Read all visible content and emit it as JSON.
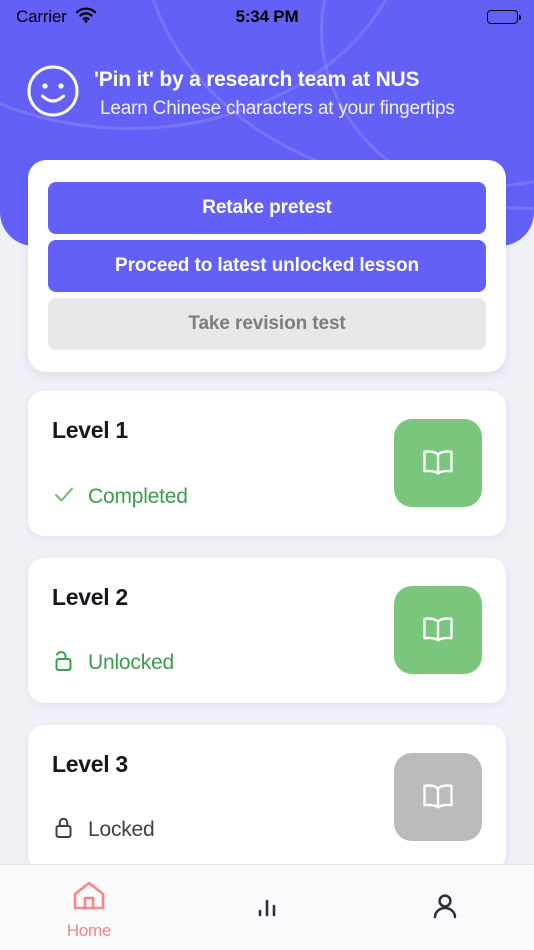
{
  "status_bar": {
    "carrier": "Carrier",
    "wifi_icon": "wifi-icon",
    "time": "5:34 PM",
    "battery_icon": "battery-full-icon"
  },
  "header": {
    "logo_icon": "smiley-face-icon",
    "title": "'Pin it' by a research team at NUS",
    "subtitle": "Learn Chinese characters at your fingertips",
    "background_color": "#6360f7"
  },
  "actions": {
    "buttons": [
      {
        "label": "Retake pretest",
        "state": "enabled"
      },
      {
        "label": "Proceed to latest unlocked lesson",
        "state": "enabled"
      },
      {
        "label": "Take revision test",
        "state": "disabled"
      }
    ]
  },
  "levels": [
    {
      "title": "Level 1",
      "status_label": "Completed",
      "status_icon": "check-icon",
      "status_color": "#3a9e4a",
      "book_icon": "open-book-icon",
      "book_color": "#7ac67c",
      "book_state": "enabled"
    },
    {
      "title": "Level 2",
      "status_label": "Unlocked",
      "status_icon": "unlock-icon",
      "status_color": "#3a9e4a",
      "book_icon": "open-book-icon",
      "book_color": "#7ac67c",
      "book_state": "enabled"
    },
    {
      "title": "Level 3",
      "status_label": "Locked",
      "status_icon": "lock-icon",
      "status_color": "#3c4049",
      "book_icon": "open-book-icon",
      "book_color": "#bbbbbb",
      "book_state": "disabled"
    }
  ],
  "tab_bar": {
    "active_color": "#fa8585",
    "inactive_color": "#2d3038",
    "tabs": [
      {
        "label": "Home",
        "icon": "home-icon",
        "active": true
      },
      {
        "label": "",
        "icon": "bar-chart-icon",
        "active": false
      },
      {
        "label": "",
        "icon": "person-icon",
        "active": false
      }
    ]
  }
}
